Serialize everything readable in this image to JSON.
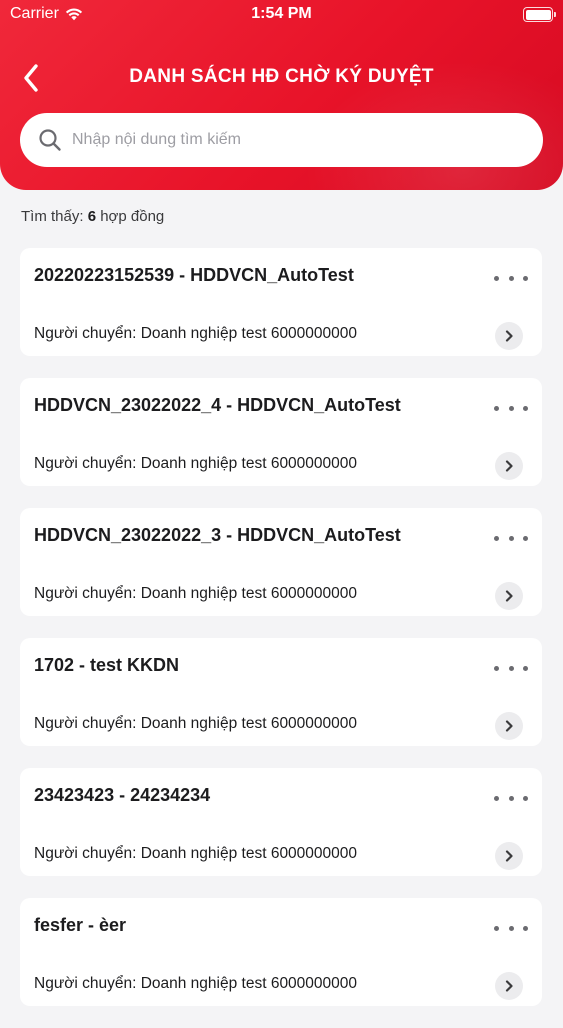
{
  "status_bar": {
    "carrier": "Carrier",
    "time": "1:54 PM"
  },
  "header": {
    "title": "DANH SÁCH HĐ CHỜ KÝ DUYỆT",
    "back_icon": "chevron-left-icon"
  },
  "search": {
    "placeholder": "Nhập nội dung tìm kiếm",
    "value": ""
  },
  "result": {
    "prefix": "Tìm thấy: ",
    "count": "6",
    "suffix": " hợp đồng"
  },
  "contracts": [
    {
      "title": "20220223152539 - HDDVCN_AutoTest",
      "sender": "Người chuyển: Doanh nghiệp test 6000000000"
    },
    {
      "title": "HDDVCN_23022022_4 - HDDVCN_AutoTest",
      "sender": "Người chuyển: Doanh nghiệp test 6000000000"
    },
    {
      "title": "HDDVCN_23022022_3 - HDDVCN_AutoTest",
      "sender": "Người chuyển: Doanh nghiệp test 6000000000"
    },
    {
      "title": "1702 - test KKDN",
      "sender": "Người chuyển: Doanh nghiệp test 6000000000"
    },
    {
      "title": "23423423 - 24234234",
      "sender": "Người chuyển: Doanh nghiệp test 6000000000"
    },
    {
      "title": "fesfer - èer",
      "sender": "Người chuyển: Doanh nghiệp test 6000000000"
    }
  ],
  "colors": {
    "brand_red": "#e81329",
    "background": "#f4f4f6",
    "card": "#ffffff"
  }
}
